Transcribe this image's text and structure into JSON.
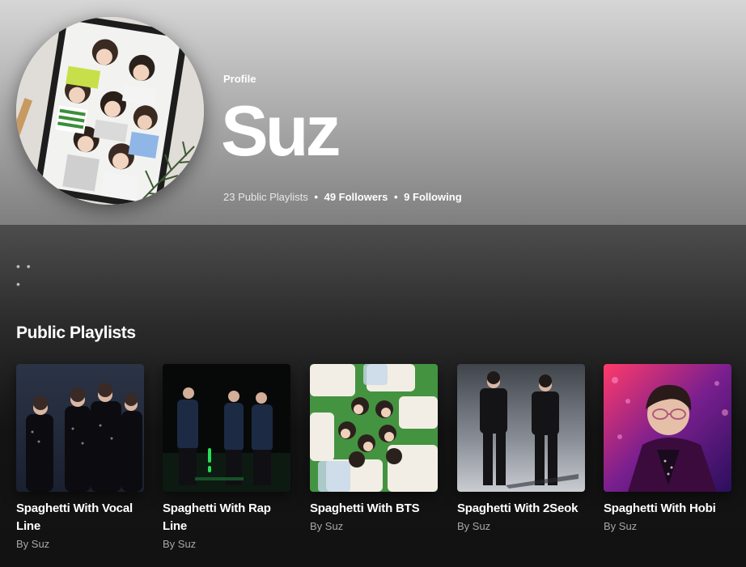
{
  "profile": {
    "label": "Profile",
    "name": "Suz",
    "public_playlists": "23 Public Playlists",
    "followers": "49 Followers",
    "following": "9 Following",
    "separator": "•"
  },
  "more_label": "• • •",
  "section": {
    "title": "Public Playlists"
  },
  "playlists": [
    {
      "title": "Spaghetti With Vocal Line",
      "subtitle": "By Suz"
    },
    {
      "title": "Spaghetti With Rap Line",
      "subtitle": "By Suz"
    },
    {
      "title": "Spaghetti With BTS",
      "subtitle": "By Suz"
    },
    {
      "title": "Spaghetti With 2Seok",
      "subtitle": "By Suz"
    },
    {
      "title": "Spaghetti With Hobi",
      "subtitle": "By Suz"
    }
  ],
  "icons": {
    "more": "more-horizontal-icon"
  }
}
